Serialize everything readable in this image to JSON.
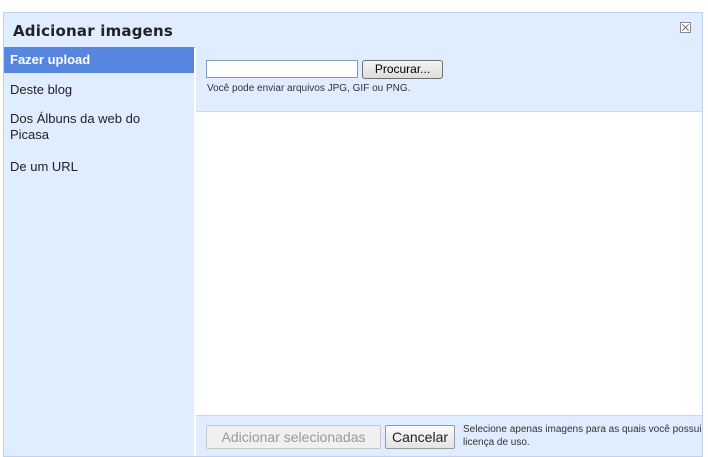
{
  "dialog": {
    "title": "Adicionar imagens",
    "close_icon": "close-icon"
  },
  "sidebar": {
    "items": [
      {
        "label": "Fazer upload",
        "active": true
      },
      {
        "label": "Deste blog",
        "active": false
      },
      {
        "label": "Dos Álbuns da web do Picasa",
        "active": false
      },
      {
        "label": "De um URL",
        "active": false
      }
    ]
  },
  "upload": {
    "file_value": "",
    "browse_label": "Procurar...",
    "hint": "Você pode enviar arquivos JPG, GIF ou PNG."
  },
  "footer": {
    "add_label": "Adicionar selecionadas",
    "cancel_label": "Cancelar",
    "note": "Selecione apenas imagens para as quais você possui licença de uso."
  },
  "colors": {
    "panel_bg": "#e0ecff",
    "active_item": "#5686e0",
    "border": "#c3d9ff"
  }
}
